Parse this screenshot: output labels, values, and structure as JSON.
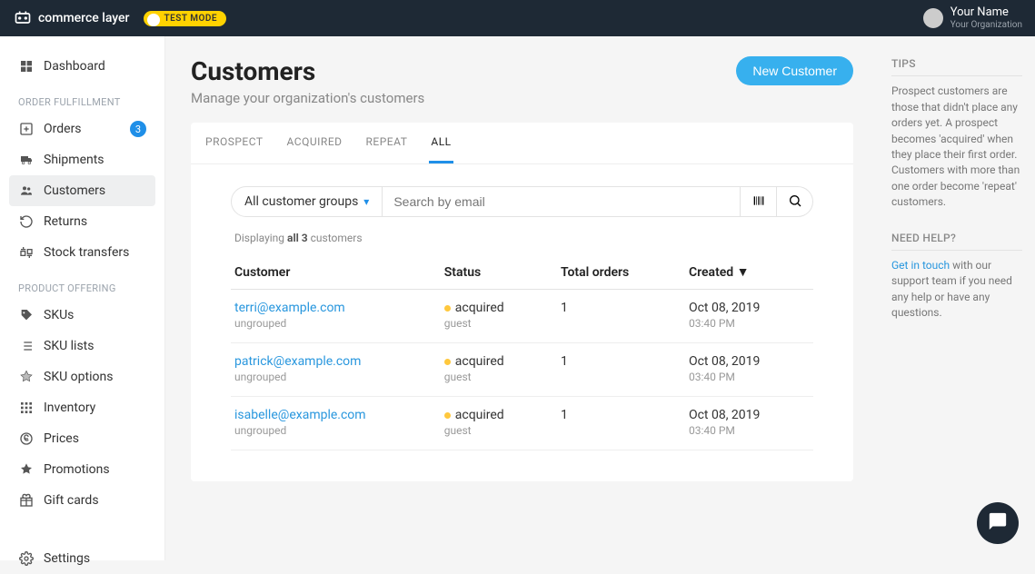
{
  "brand": "commerce layer",
  "test_mode": "TEST MODE",
  "user": {
    "name": "Your Name",
    "org": "Your Organization"
  },
  "sidebar": {
    "dashboard": "Dashboard",
    "section_orders": "ORDER FULFILLMENT",
    "orders": "Orders",
    "orders_badge": "3",
    "shipments": "Shipments",
    "customers": "Customers",
    "returns": "Returns",
    "stock_transfers": "Stock transfers",
    "section_product": "PRODUCT OFFERING",
    "skus": "SKUs",
    "sku_lists": "SKU lists",
    "sku_options": "SKU options",
    "inventory": "Inventory",
    "prices": "Prices",
    "promotions": "Promotions",
    "gift_cards": "Gift cards",
    "settings": "Settings"
  },
  "page": {
    "title": "Customers",
    "subtitle": "Manage your organization's customers",
    "new_button": "New Customer"
  },
  "tabs": {
    "prospect": "PROSPECT",
    "acquired": "ACQUIRED",
    "repeat": "REPEAT",
    "all": "ALL"
  },
  "filter": {
    "group_select": "All customer groups",
    "search_placeholder": "Search by email"
  },
  "count": {
    "prefix": "Displaying ",
    "bold": "all 3",
    "suffix": " customers"
  },
  "columns": {
    "customer": "Customer",
    "status": "Status",
    "orders": "Total orders",
    "created": "Created ▼"
  },
  "rows": [
    {
      "email": "terri@example.com",
      "group": "ungrouped",
      "status": "acquired",
      "status_sub": "guest",
      "orders": "1",
      "date": "Oct 08, 2019",
      "time": "03:40 PM"
    },
    {
      "email": "patrick@example.com",
      "group": "ungrouped",
      "status": "acquired",
      "status_sub": "guest",
      "orders": "1",
      "date": "Oct 08, 2019",
      "time": "03:40 PM"
    },
    {
      "email": "isabelle@example.com",
      "group": "ungrouped",
      "status": "acquired",
      "status_sub": "guest",
      "orders": "1",
      "date": "Oct 08, 2019",
      "time": "03:40 PM"
    }
  ],
  "tips": {
    "heading": "TIPS",
    "body": "Prospect customers are those that didn't place any orders yet. A prospect becomes 'acquired' when they place their first order. Customers with more than one order become 'repeat' customers."
  },
  "help": {
    "heading": "NEED HELP?",
    "link": "Get in touch",
    "body": " with our support team if you need any help or have any questions."
  }
}
